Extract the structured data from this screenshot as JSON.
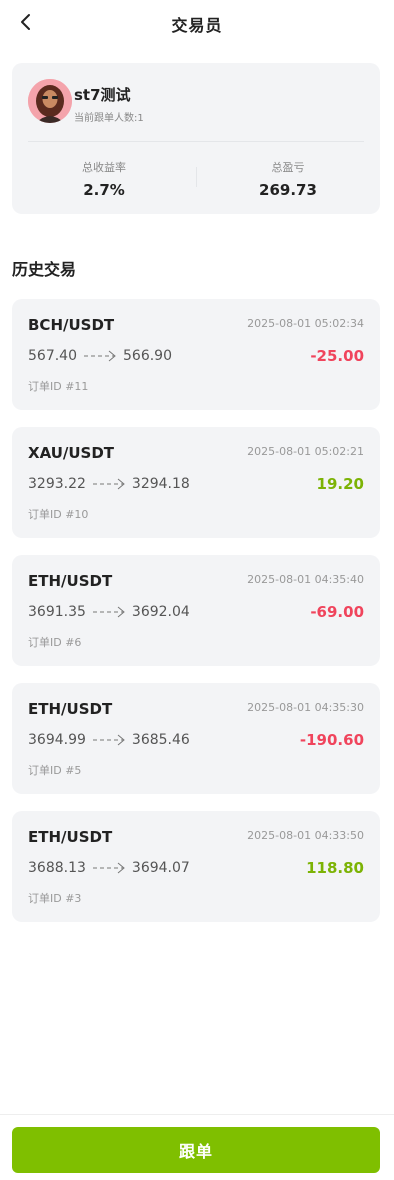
{
  "header": {
    "title": "交易员",
    "back_icon": "chevron-left-icon"
  },
  "profile": {
    "name": "st7测试",
    "followers_text": "当前跟单人数:1",
    "total_yield_label": "总收益率",
    "total_yield_value": "2.7%",
    "total_pnl_label": "总盈亏",
    "total_pnl_value": "269.73"
  },
  "history": {
    "title": "历史交易",
    "trades": [
      {
        "pair": "BCH/USDT",
        "time": "2025-08-01 05:02:34",
        "open": "567.40",
        "close": "566.90",
        "pnl": "-25.00",
        "order_id": "订单ID #11",
        "direction": "loss"
      },
      {
        "pair": "XAU/USDT",
        "time": "2025-08-01 05:02:21",
        "open": "3293.22",
        "close": "3294.18",
        "pnl": "19.20",
        "order_id": "订单ID #10",
        "direction": "profit"
      },
      {
        "pair": "ETH/USDT",
        "time": "2025-08-01 04:35:40",
        "open": "3691.35",
        "close": "3692.04",
        "pnl": "-69.00",
        "order_id": "订单ID #6",
        "direction": "loss"
      },
      {
        "pair": "ETH/USDT",
        "time": "2025-08-01 04:35:30",
        "open": "3694.99",
        "close": "3685.46",
        "pnl": "-190.60",
        "order_id": "订单ID #5",
        "direction": "loss"
      },
      {
        "pair": "ETH/USDT",
        "time": "2025-08-01 04:33:50",
        "open": "3688.13",
        "close": "3694.07",
        "pnl": "118.80",
        "order_id": "订单ID #3",
        "direction": "profit"
      }
    ]
  },
  "footer": {
    "follow_label": "跟单"
  },
  "colors": {
    "profit": "#7cb305",
    "loss": "#f0445c",
    "accent": "#7fbf00"
  }
}
